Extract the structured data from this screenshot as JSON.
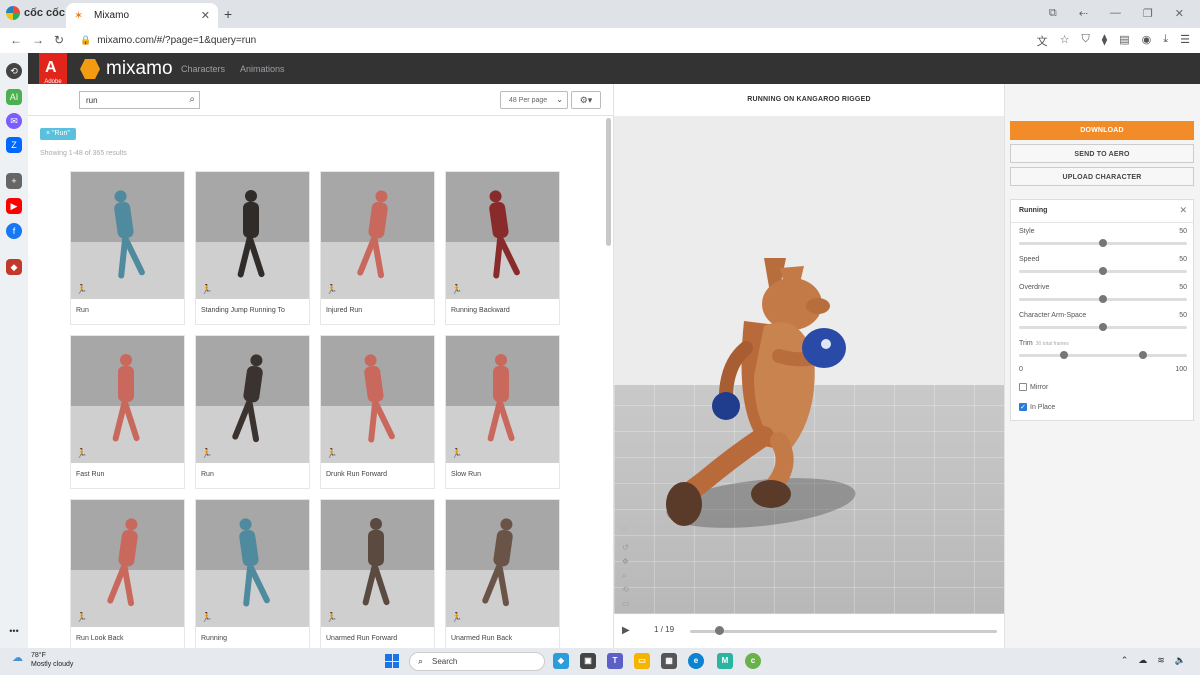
{
  "browser": {
    "brand": "cốc cốc",
    "tab_title": "Mixamo",
    "url": "mixamo.com/#/?page=1&query=run"
  },
  "header": {
    "adobe_label": "Adobe",
    "logo_text": "mixamo",
    "nav": [
      "Characters",
      "Animations"
    ]
  },
  "search": {
    "value": "run",
    "per_page": "48 Per page",
    "chip": "× \"Run\"",
    "results": "Showing 1-48 of 365 results"
  },
  "cards": [
    {
      "label": "Run",
      "color": "#4f8a9e"
    },
    {
      "label": "Standing Jump Running To",
      "color": "#2f2c2a"
    },
    {
      "label": "Injured Run",
      "color": "#c9685d"
    },
    {
      "label": "Running Backward",
      "color": "#8a2b2b"
    },
    {
      "label": "Fast Run",
      "color": "#c9685d"
    },
    {
      "label": "Run",
      "color": "#3b3330"
    },
    {
      "label": "Drunk Run Forward",
      "color": "#c9685d"
    },
    {
      "label": "Slow Run",
      "color": "#c9685d"
    },
    {
      "label": "Run Look Back",
      "color": "#c9685d"
    },
    {
      "label": "Running",
      "color": "#4f8a9e"
    },
    {
      "label": "Unarmed Run Forward",
      "color": "#5a4a40"
    },
    {
      "label": "Unarmed Run Back",
      "color": "#6a5448"
    }
  ],
  "viewport": {
    "title": "RUNNING ON KANGAROO RIGGED",
    "frame": "1 / 19",
    "frame_progress": 0.08
  },
  "actions": {
    "download": "DOWNLOAD",
    "send_to_aero": "SEND TO AERO",
    "upload": "UPLOAD CHARACTER"
  },
  "settings": {
    "title": "Running",
    "params": [
      {
        "name": "Style",
        "value": "50",
        "fraction": 0.5
      },
      {
        "name": "Speed",
        "value": "50",
        "fraction": 0.5
      },
      {
        "name": "Overdrive",
        "value": "50",
        "fraction": 0.5
      },
      {
        "name": "Character Arm-Space",
        "value": "50",
        "fraction": 0.5
      }
    ],
    "trim": {
      "name": "Trim",
      "sub": "30 total frames",
      "min": "0",
      "max": "100",
      "start": 0.27,
      "end": 0.74
    },
    "mirror": {
      "label": "Mirror",
      "checked": false
    },
    "in_place": {
      "label": "In Place",
      "checked": true
    }
  },
  "taskbar": {
    "temp": "78°F",
    "weather": "Mostly cloudy",
    "search": "Search"
  }
}
